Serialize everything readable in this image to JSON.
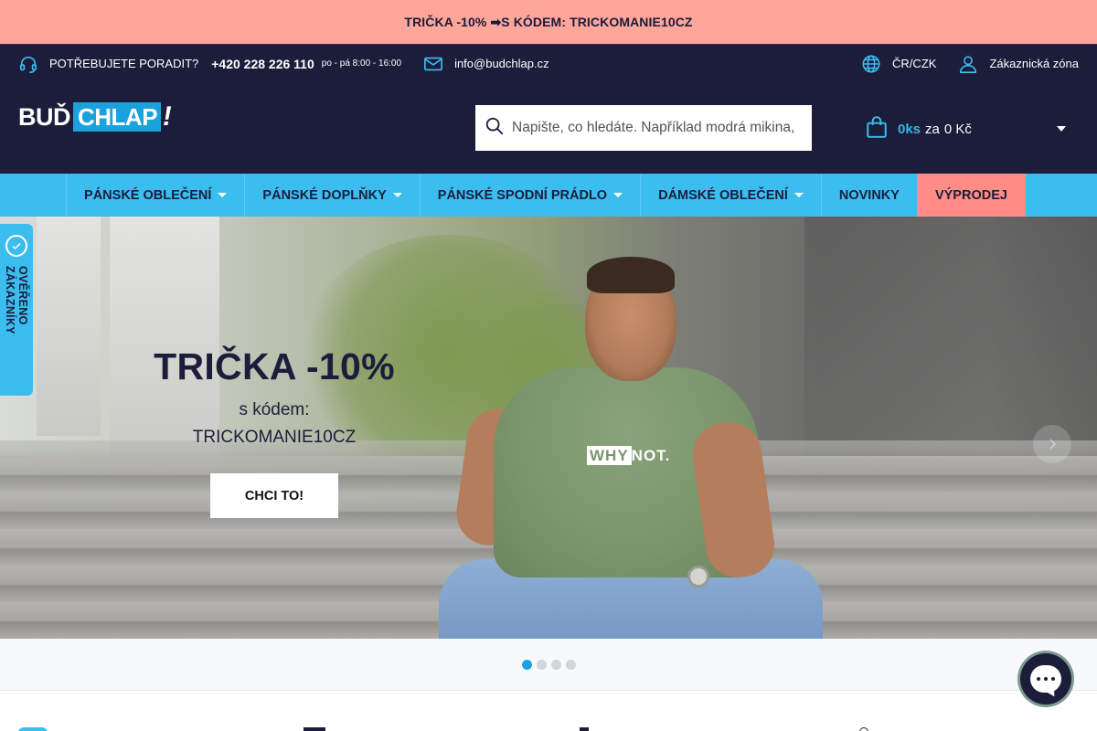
{
  "promo": {
    "text": "TRIČKA  -10% ➡S KÓDEM: TRICKOMANIE10CZ"
  },
  "topbar": {
    "advice_label": "POTŘEBUJETE PORADIT?",
    "phone": "+420 228 226 110",
    "hours": "po - pá 8:00 - 16:00",
    "email": "info@budchlap.cz",
    "region": "ČR/CZK",
    "account": "Zákaznická zóna",
    "icons": {
      "headset": "headset-icon",
      "mail": "mail-icon",
      "globe": "globe-icon",
      "user": "user-icon"
    }
  },
  "header": {
    "logo": {
      "part1": "BUĎ",
      "part2": "CHLAP",
      "part3": "!"
    },
    "search": {
      "placeholder": "Napište, co hledáte. Například modrá mikina,",
      "value": ""
    },
    "cart": {
      "count": "0ks",
      "za": "za",
      "sum": "0 Kč"
    }
  },
  "nav": {
    "items": [
      {
        "label": "PÁNSKÉ OBLEČENÍ",
        "dropdown": true
      },
      {
        "label": "PÁNSKÉ DOPLŇKY",
        "dropdown": true
      },
      {
        "label": "PÁNSKÉ SPODNÍ PRÁDLO",
        "dropdown": true
      },
      {
        "label": "DÁMSKÉ OBLEČENÍ",
        "dropdown": true
      },
      {
        "label": "NOVINKY",
        "dropdown": false
      },
      {
        "label": "VÝPRODEJ",
        "dropdown": false
      }
    ]
  },
  "hero": {
    "title": "TRIČKA -10%",
    "sub1": "s kódem:",
    "sub2": "TRICKOMANIE10CZ",
    "cta": "CHCI TO!",
    "shirt_print_a": "WHY",
    "shirt_print_b": "NOT."
  },
  "badge": {
    "text": "OVĚŘENO ZÁKAZNÍKY"
  },
  "slider": {
    "dots": 4,
    "active_index": 0
  },
  "colors": {
    "navy": "#1c1d3b",
    "promo_bg": "#ffa69b",
    "nav_bg": "#3cbdef",
    "sale_bg": "#ff8d86",
    "accent": "#1aa3e0"
  }
}
